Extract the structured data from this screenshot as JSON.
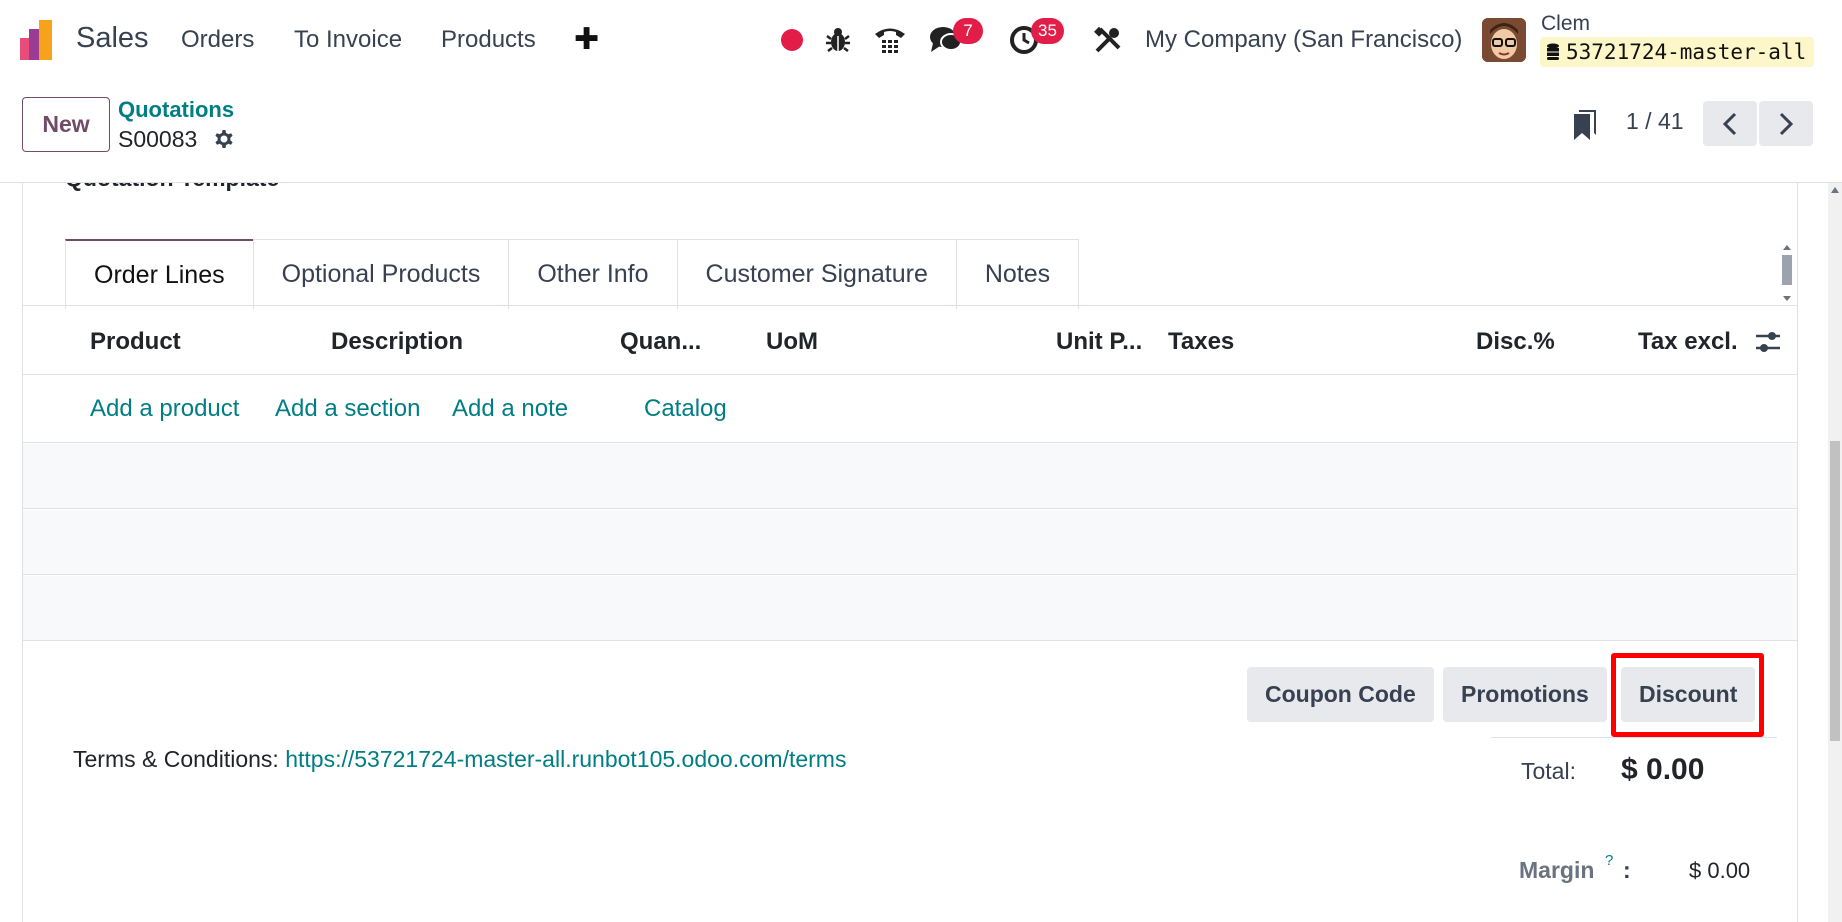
{
  "navbar": {
    "app_name": "Sales",
    "menu": [
      "Orders",
      "To Invoice",
      "Products"
    ],
    "icons": [
      "record-dot-icon",
      "bug-icon",
      "phone-icon",
      "chat-icon",
      "clock-icon",
      "tools-icon"
    ],
    "chat_badge": "7",
    "activity_badge": "35",
    "company": "My Company (San Francisco)",
    "user_name": "Clem",
    "database": "53721724-master-all",
    "colors": {
      "record_dot": "#e11d48",
      "badge": "#e11d48"
    }
  },
  "control_panel": {
    "new_label": "New",
    "breadcrumb": "Quotations",
    "record_name": "S00083",
    "pager": "1 / 41"
  },
  "form": {
    "clipped_label": "Quotation Template",
    "tabs": [
      "Order Lines",
      "Optional Products",
      "Other Info",
      "Customer Signature",
      "Notes"
    ],
    "columns": [
      "Product",
      "Description",
      "Quan...",
      "UoM",
      "Unit P...",
      "Taxes",
      "Disc.%",
      "Tax excl."
    ],
    "add_links": [
      "Add a product",
      "Add a section",
      "Add a note",
      "Catalog"
    ],
    "buttons": [
      "Coupon Code",
      "Promotions",
      "Discount"
    ],
    "terms_label": "Terms & Conditions:",
    "terms_link": "https://53721724-master-all.runbot105.odoo.com/terms",
    "total_label": "Total:",
    "total_value": "$ 0.00",
    "margin_label": "Margin",
    "margin_help": "?",
    "margin_colon": ":",
    "margin_value": "$ 0.00"
  },
  "theme": {
    "primary": "#714b67",
    "link": "#017e84",
    "highlight": "#ff0000"
  }
}
